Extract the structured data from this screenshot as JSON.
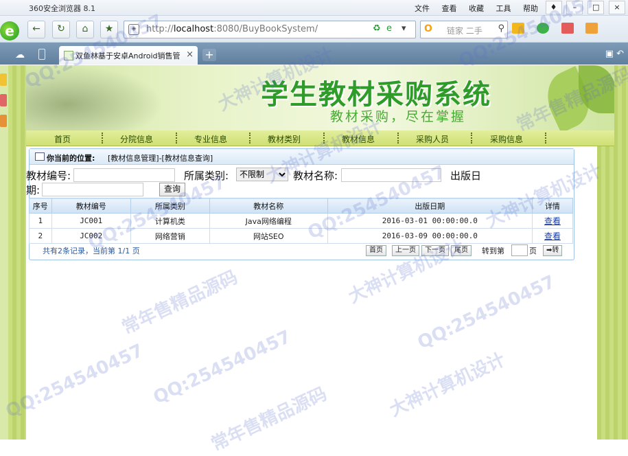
{
  "browser": {
    "app_title": "360安全浏览器 8.1",
    "menu": [
      "文件",
      "查看",
      "收藏",
      "工具",
      "帮助"
    ],
    "url_gray": "http://",
    "url_host": "localhost",
    "url_rest": ":8080/BuyBookSystem/",
    "search_placeholder": "链家 二手",
    "search_engine": "O",
    "tab_title": "双鱼林基于安卓Android销售管",
    "tab_close": "×",
    "new_tab": "+"
  },
  "banner": {
    "title": "学生教材采购系统",
    "slogan": "教材采购，尽在掌握"
  },
  "nav": [
    "首页",
    "分院信息",
    "专业信息",
    "教材类别",
    "教材信息",
    "采购人员",
    "采购信息"
  ],
  "location": {
    "label": "你当前的位置:",
    "crumb": "[教材信息管理]-[教材信息查询]"
  },
  "filters": {
    "code_label": "教材编号:",
    "category_label": "所属类别:",
    "category_value": "不限制",
    "name_label": "教材名称:",
    "date_label_1": "出版日",
    "date_label_2": "期:",
    "query_button": "查询"
  },
  "table": {
    "headers": [
      "序号",
      "教材编号",
      "所属类别",
      "教材名称",
      "出版日期",
      "详情"
    ],
    "rows": [
      {
        "no": "1",
        "code": "JC001",
        "category": "计算机类",
        "name": "Java网络编程",
        "date": "2016-03-01 00:00:00.0",
        "link": "查看"
      },
      {
        "no": "2",
        "code": "JC002",
        "category": "网络营销",
        "name": "网站SEO",
        "date": "2016-03-09 00:00:00.0",
        "link": "查看"
      }
    ]
  },
  "pager": {
    "summary": "共有2条记录，当前第 1/1 页",
    "first": "首页",
    "prev": "上一页",
    "next": "下一页",
    "last": "尾页",
    "goto_label": "转到第",
    "page_suffix": "页",
    "go_button": "➡转"
  },
  "watermarks": [
    "QQ:254540457",
    "大神计算机设计",
    "常年售精品源码"
  ],
  "colors": {
    "accent_green": "#2f9b28",
    "link_blue": "#1a3fa8",
    "panel_border": "#9ec3e6"
  }
}
